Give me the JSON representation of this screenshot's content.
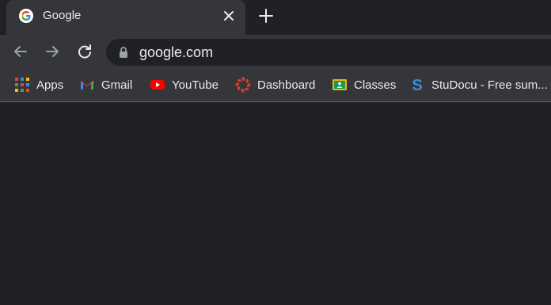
{
  "tab": {
    "title": "Google",
    "favicon": "google-g-icon"
  },
  "toolbar": {
    "back_icon": "back-arrow-icon",
    "forward_icon": "forward-arrow-icon",
    "reload_icon": "reload-icon",
    "url": "google.com",
    "lock_icon": "lock-icon"
  },
  "bookmarks": [
    {
      "label": "Apps",
      "icon": "apps-grid-icon"
    },
    {
      "label": "Gmail",
      "icon": "gmail-icon"
    },
    {
      "label": "YouTube",
      "icon": "youtube-icon"
    },
    {
      "label": "Dashboard",
      "icon": "dashboard-icon"
    },
    {
      "label": "Classes",
      "icon": "classroom-icon"
    },
    {
      "label": "StuDocu - Free sum...",
      "icon": "studocu-icon"
    }
  ],
  "colors": {
    "background": "#202124",
    "toolbar": "#35363a",
    "text": "#e8eaed"
  }
}
